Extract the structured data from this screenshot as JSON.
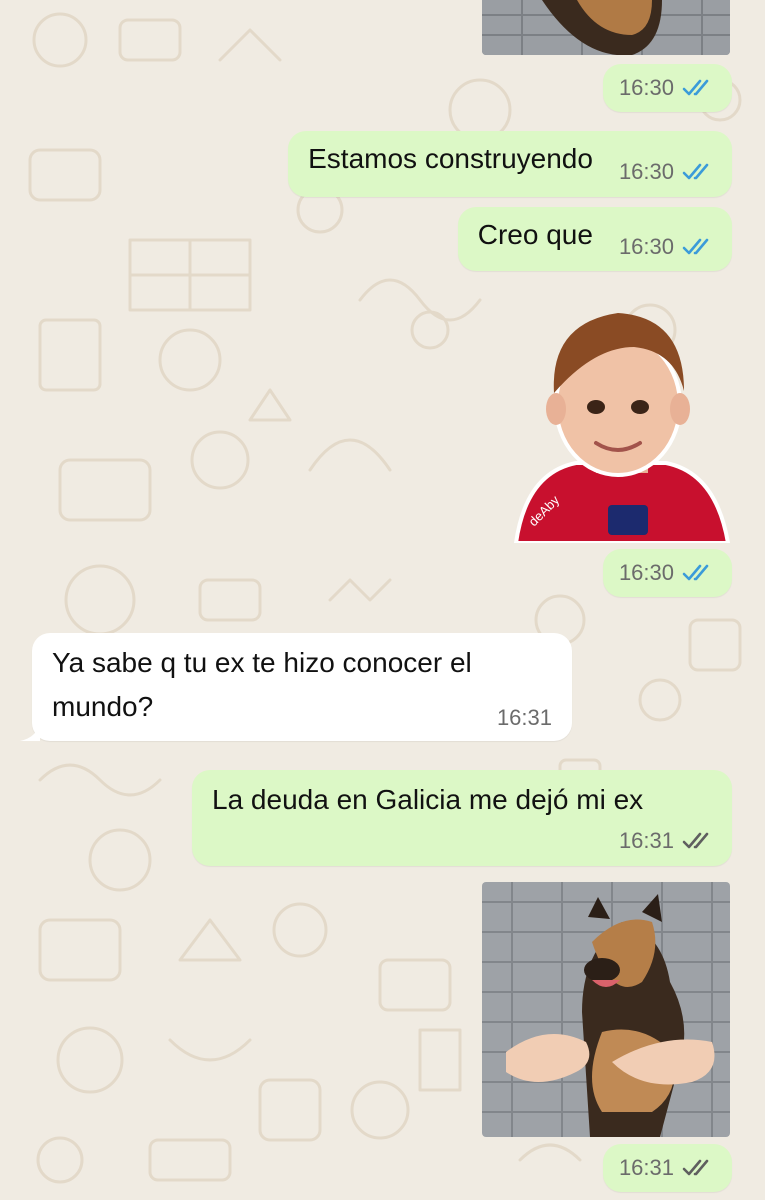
{
  "colors": {
    "outgoing_bubble": "#dcf8c6",
    "incoming_bubble": "#ffffff",
    "read_ticks": "#3b9bd9",
    "delivered_ticks": "#5f5f5f",
    "wallpaper": "#f0ebe2"
  },
  "messages": [
    {
      "type": "image",
      "direction": "out",
      "content": "dog photo (top, cropped)",
      "time": "16:30",
      "status": "read"
    },
    {
      "type": "text",
      "direction": "out",
      "text": "Estamos construyendo",
      "time": "16:30",
      "status": "read"
    },
    {
      "type": "text",
      "direction": "out",
      "text": "Creo que",
      "time": "16:30",
      "status": "read"
    },
    {
      "type": "sticker",
      "direction": "out",
      "watermark": "deAby",
      "time": "16:30",
      "status": "read"
    },
    {
      "type": "text",
      "direction": "in",
      "text_line1": "Ya sabe q tu ex te hizo conocer el",
      "text_line2": "mundo?",
      "time": "16:31"
    },
    {
      "type": "text",
      "direction": "out",
      "text": "La deuda en Galicia me dejó mi ex",
      "time": "16:31",
      "status": "delivered"
    },
    {
      "type": "image",
      "direction": "out",
      "content": "dog photo",
      "time": "16:31",
      "status": "delivered"
    }
  ]
}
